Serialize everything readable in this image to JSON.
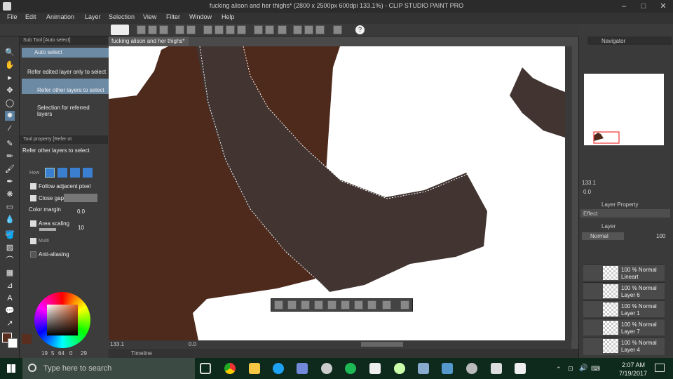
{
  "window": {
    "title": "fucking alison and her thighs* (2800 x 2500px 600dpi 133.1%)  - CLIP STUDIO PAINT PRO"
  },
  "menu": [
    "File",
    "Edit",
    "Animation",
    "Layer",
    "Selection",
    "View",
    "Filter",
    "Window",
    "Help"
  ],
  "subtool": {
    "header": "Sub Tool [Auto select]",
    "items": [
      "Auto select",
      "Refer edited layer only to select",
      "Refer other layers to select",
      "Selection for referred layers"
    ]
  },
  "toolprop": {
    "header": "Tool property [Refer ot",
    "title": "Refer other layers to select",
    "how_label": "How",
    "follow_adjacent": "Follow adjacent pixel",
    "close_gap": "Close gap",
    "color_margin_label": "Color margin",
    "color_margin_value": "0.0",
    "area_scaling": "Area scaling",
    "area_scaling_value": "10",
    "multi": "Multi",
    "anti_alias": "Anti-aliasing"
  },
  "color": {
    "fg": "#5a2e1e",
    "nums": [
      "19",
      "5",
      "64",
      "0",
      "29"
    ],
    "brown": "#4e2a1c",
    "dark": "#413431"
  },
  "canvas": {
    "doc_tab": "fucking alison and her thighs*",
    "zoom": "133.1",
    "status_val": "0.0"
  },
  "timeline": {
    "label": "Timeline"
  },
  "navigator": {
    "header": "Navigator",
    "zoom": "133.1",
    "angle": "0.0"
  },
  "layer_property": {
    "header": "Layer Property",
    "effect": "Effect"
  },
  "layers": {
    "header": "Layer",
    "blend": "Normal",
    "opacity": "100",
    "items": [
      {
        "mode": "100 % Normal",
        "name": "Lineart"
      },
      {
        "mode": "100 % Normal",
        "name": "Layer 6"
      },
      {
        "mode": "100 % Normal",
        "name": "Layer 1"
      },
      {
        "mode": "100 % Normal",
        "name": "Layer 7"
      },
      {
        "mode": "100 % Normal",
        "name": "Layer 4"
      }
    ]
  },
  "taskbar": {
    "search_placeholder": "Type here to search",
    "time": "2:07 AM",
    "date": "7/19/2017"
  }
}
